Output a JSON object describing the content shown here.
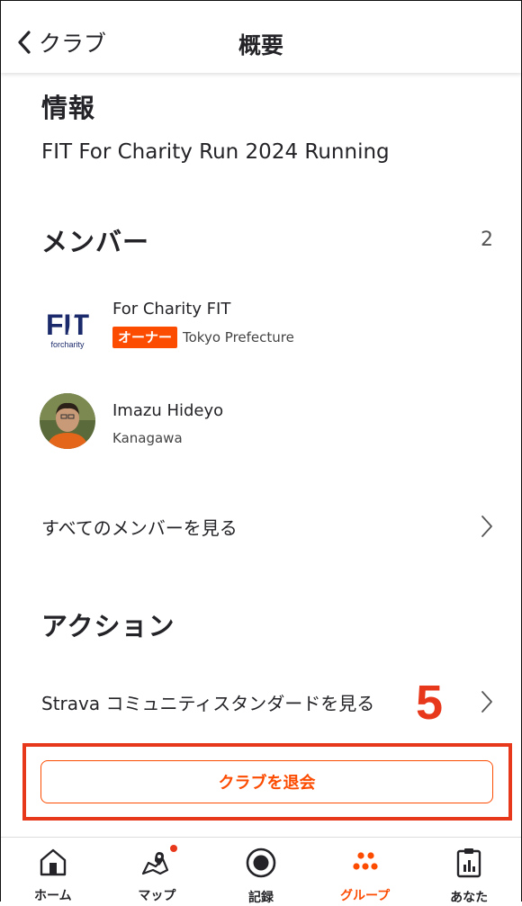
{
  "header": {
    "back_label": "クラブ",
    "title": "概要"
  },
  "info": {
    "title": "情報",
    "text": "FIT For Charity Run 2024 Running"
  },
  "members": {
    "title": "メンバー",
    "count": "2",
    "items": [
      {
        "name": "For Charity FIT",
        "badge": "オーナー",
        "location": "Tokyo Prefecture",
        "logo_text": "FIT",
        "logo_sub": "forcharity"
      },
      {
        "name": "Imazu Hideyo",
        "location": "Kanagawa"
      }
    ],
    "see_all": "すべてのメンバーを見る"
  },
  "actions": {
    "title": "アクション",
    "standards": "Strava コミュニティスタンダードを見る",
    "step_number": "5",
    "leave_button": "クラブを退会"
  },
  "tabbar": {
    "items": [
      {
        "label": "ホーム",
        "icon": "home-icon"
      },
      {
        "label": "マップ",
        "icon": "map-icon"
      },
      {
        "label": "記録",
        "icon": "record-icon"
      },
      {
        "label": "グループ",
        "icon": "groups-icon",
        "active": true
      },
      {
        "label": "あなた",
        "icon": "profile-stats-icon"
      }
    ]
  },
  "colors": {
    "accent": "#fc4c02",
    "annotation": "#e8381c",
    "text": "#242428"
  }
}
